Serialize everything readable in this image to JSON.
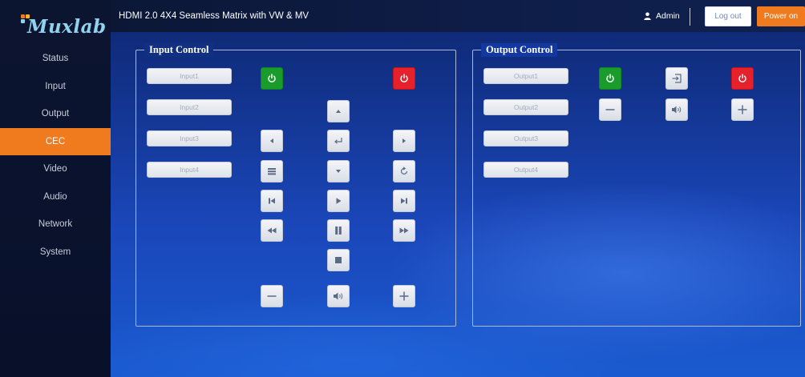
{
  "brand": {
    "name": "Muxlab"
  },
  "header": {
    "title": "HDMI 2.0 4X4 Seamless Matrix with VW & MV",
    "user": "Admin",
    "logout_label": "Log out",
    "poweron_label": "Power on"
  },
  "sidebar": {
    "items": [
      {
        "label": "Status",
        "active": false
      },
      {
        "label": "Input",
        "active": false
      },
      {
        "label": "Output",
        "active": false
      },
      {
        "label": "CEC",
        "active": true
      },
      {
        "label": "Video",
        "active": false
      },
      {
        "label": "Audio",
        "active": false
      },
      {
        "label": "Network",
        "active": false
      },
      {
        "label": "System",
        "active": false
      }
    ]
  },
  "input_control": {
    "title": "Input Control",
    "sources": [
      "Input1",
      "Input2",
      "Input3",
      "Input4"
    ],
    "buttons": [
      {
        "name": "power-on",
        "icon": "power-icon",
        "color": "#1a9c2c"
      },
      {
        "name": "power-off",
        "icon": "power-icon",
        "color": "#e5212b"
      },
      {
        "name": "up",
        "icon": "arrow-up-icon"
      },
      {
        "name": "left",
        "icon": "arrow-left-icon"
      },
      {
        "name": "enter",
        "icon": "enter-icon"
      },
      {
        "name": "right",
        "icon": "arrow-right-icon"
      },
      {
        "name": "menu",
        "icon": "menu-icon"
      },
      {
        "name": "down",
        "icon": "arrow-down-icon"
      },
      {
        "name": "back",
        "icon": "back-icon"
      },
      {
        "name": "previous",
        "icon": "skip-previous-icon"
      },
      {
        "name": "play",
        "icon": "play-icon"
      },
      {
        "name": "next",
        "icon": "skip-next-icon"
      },
      {
        "name": "rewind",
        "icon": "rewind-icon"
      },
      {
        "name": "pause",
        "icon": "pause-icon"
      },
      {
        "name": "fast-forward",
        "icon": "fast-forward-icon"
      },
      {
        "name": "stop",
        "icon": "stop-icon"
      },
      {
        "name": "volume-down",
        "icon": "minus-icon"
      },
      {
        "name": "mute",
        "icon": "speaker-icon"
      },
      {
        "name": "volume-up",
        "icon": "plus-icon"
      }
    ]
  },
  "output_control": {
    "title": "Output Control",
    "sources": [
      "Output1",
      "Output2",
      "Output3",
      "Output4"
    ],
    "buttons": [
      {
        "name": "power-on",
        "icon": "power-icon",
        "color": "#1a9c2c"
      },
      {
        "name": "source",
        "icon": "input-source-icon"
      },
      {
        "name": "power-off",
        "icon": "power-icon",
        "color": "#e5212b"
      },
      {
        "name": "volume-down",
        "icon": "minus-icon"
      },
      {
        "name": "mute",
        "icon": "speaker-icon"
      },
      {
        "name": "volume-up",
        "icon": "plus-icon"
      }
    ]
  },
  "colors": {
    "accent": "#f07a1e",
    "sidebar": "#0c1530",
    "main_bg": "#1a46b8"
  }
}
